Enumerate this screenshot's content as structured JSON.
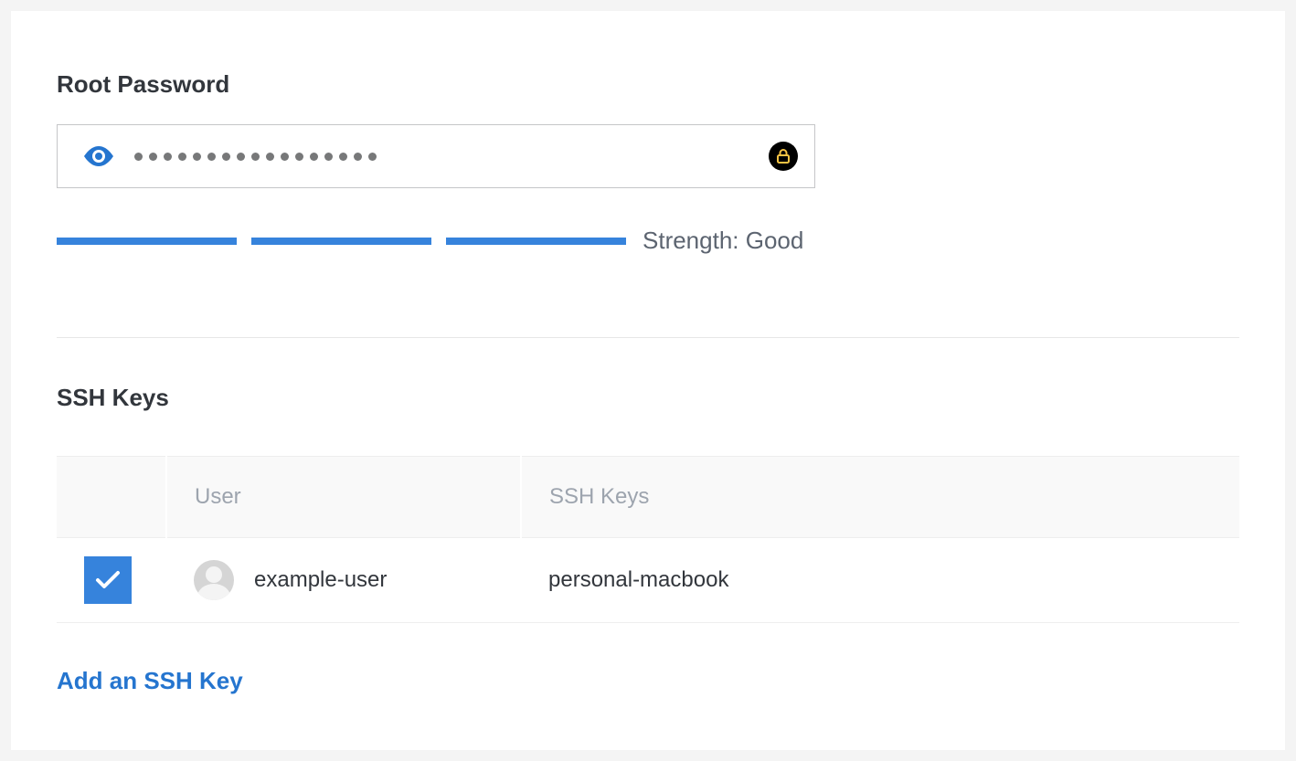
{
  "root_password": {
    "label": "Root Password",
    "masked_length": 17,
    "strength_bars_filled": 3,
    "strength_prefix": "Strength: ",
    "strength_value": "Good"
  },
  "ssh_keys": {
    "heading": "SSH Keys",
    "columns": {
      "user": "User",
      "keys": "SSH Keys"
    },
    "rows": [
      {
        "checked": true,
        "user": "example-user",
        "key_label": "personal-macbook"
      }
    ],
    "add_link": "Add an SSH Key"
  },
  "icons": {
    "eye": "eye-icon",
    "keychain": "keychain-icon",
    "avatar": "avatar-icon",
    "check": "check-icon"
  },
  "colors": {
    "accent": "#3683dc",
    "link": "#2575cf",
    "text": "#32363c",
    "muted": "#9da4ae"
  }
}
